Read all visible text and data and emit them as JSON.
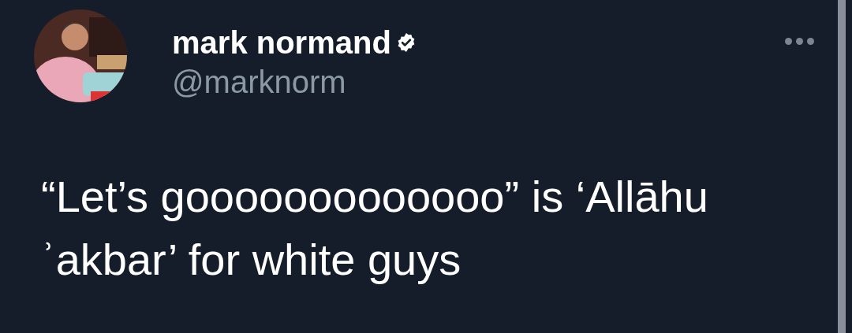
{
  "tweet": {
    "display_name": "mark normand",
    "verified": true,
    "handle": "@marknorm",
    "text": "“Let’s gooooooooooooo” is ‘Allāhu ʾakbar’ for white guys"
  }
}
